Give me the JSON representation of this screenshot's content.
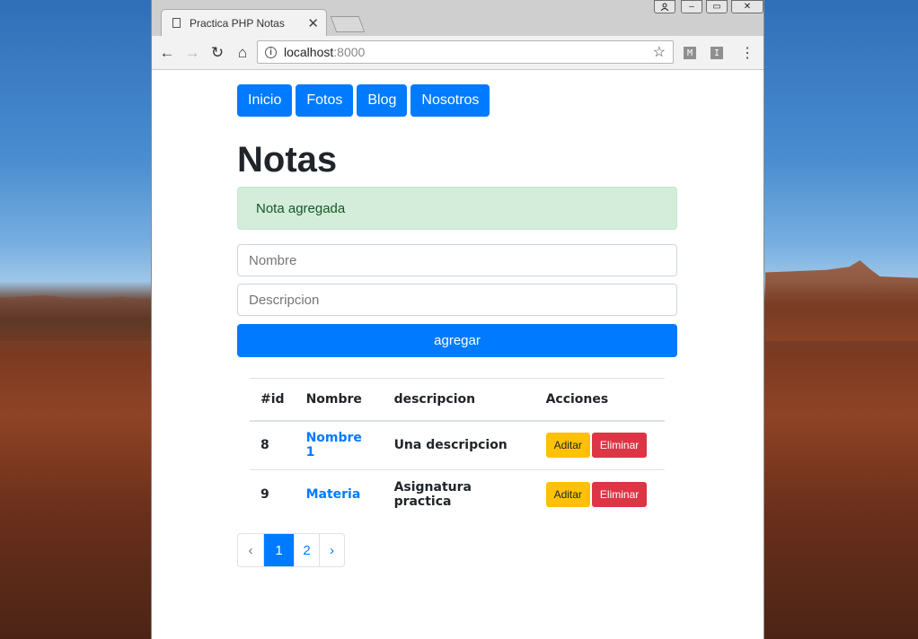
{
  "browser": {
    "tab_title": "Practica PHP Notas",
    "tab_close": "✕",
    "url_host": "localhost",
    "url_port": ":8000",
    "back": "←",
    "forward": "→",
    "reload": "↻",
    "home": "⌂",
    "star": "☆",
    "ext1": "M",
    "ext2": "I",
    "menu": "⋮",
    "win_user": "👤",
    "win_min": "–",
    "win_max": "▭",
    "win_close": "✕"
  },
  "nav": [
    {
      "label": "Inicio"
    },
    {
      "label": "Fotos"
    },
    {
      "label": "Blog"
    },
    {
      "label": "Nosotros"
    }
  ],
  "page_title": "Notas",
  "alert": "Nota agregada",
  "form": {
    "name_placeholder": "Nombre",
    "desc_placeholder": "Descripcion",
    "submit": "agregar"
  },
  "table": {
    "headers": [
      "#id",
      "Nombre",
      "descripcion",
      "Acciones"
    ],
    "rows": [
      {
        "id": "8",
        "nombre": "Nombre 1",
        "descripcion": "Una descripcion",
        "edit": "Aditar",
        "delete": "Eliminar"
      },
      {
        "id": "9",
        "nombre": "Materia",
        "descripcion": "Asignatura practica",
        "edit": "Aditar",
        "delete": "Eliminar"
      }
    ]
  },
  "pagination": {
    "prev": "‹",
    "pages": [
      "1",
      "2"
    ],
    "next": "›",
    "active_page": "1"
  },
  "colors": {
    "primary": "#007bff",
    "warning": "#ffc107",
    "danger": "#dc3545",
    "success_bg": "#d4edda"
  }
}
